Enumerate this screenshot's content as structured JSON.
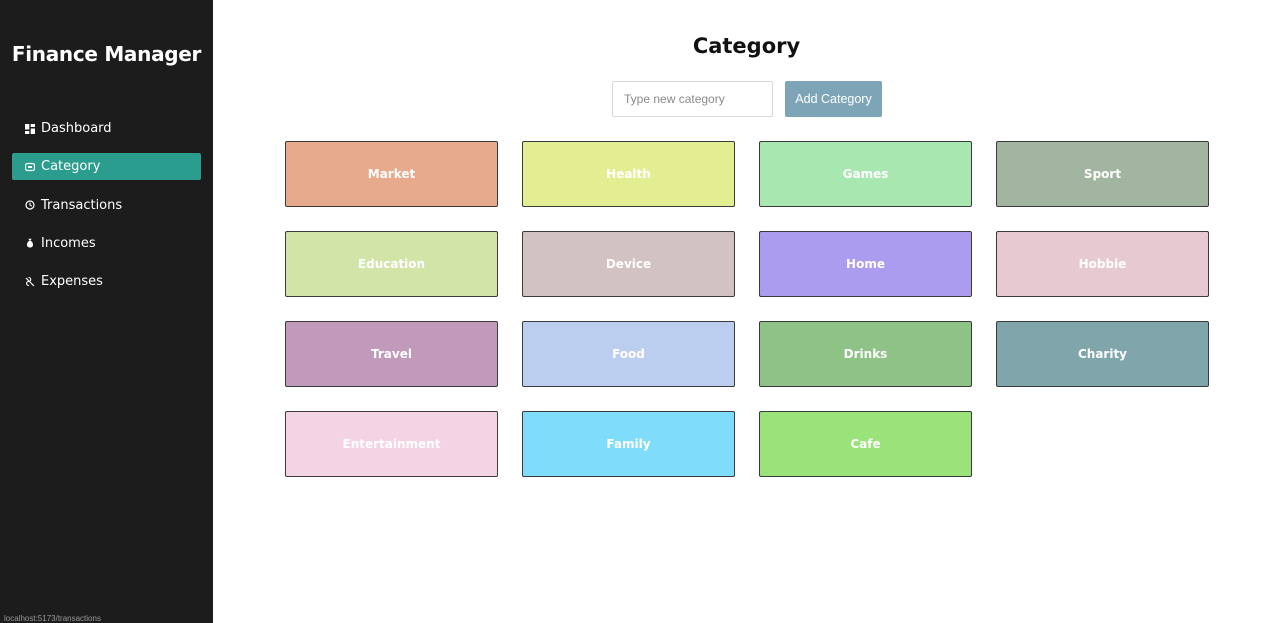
{
  "sidebar": {
    "brand": "Finance Manager",
    "items": [
      {
        "label": "Dashboard",
        "icon": "dashboard-icon",
        "active": false
      },
      {
        "label": "Category",
        "icon": "category-icon",
        "active": true
      },
      {
        "label": "Transactions",
        "icon": "history-icon",
        "active": false
      },
      {
        "label": "Incomes",
        "icon": "money-bag-icon",
        "active": false
      },
      {
        "label": "Expenses",
        "icon": "expenses-icon",
        "active": false
      }
    ],
    "active_color": "#2a9d8f",
    "status_url": "localhost:5173/transactions"
  },
  "main": {
    "title": "Category",
    "input_placeholder": "Type new category",
    "input_value": "",
    "add_button_label": "Add Category",
    "categories": [
      {
        "name": "Market",
        "color": "#e8aa8c"
      },
      {
        "name": "Health",
        "color": "#e3ee93"
      },
      {
        "name": "Games",
        "color": "#a9e7b1"
      },
      {
        "name": "Sport",
        "color": "#a2b5a0"
      },
      {
        "name": "Education",
        "color": "#d2e4a8"
      },
      {
        "name": "Device",
        "color": "#d2c2c2"
      },
      {
        "name": "Home",
        "color": "#ac9cf0"
      },
      {
        "name": "Hobbie",
        "color": "#e7cad1"
      },
      {
        "name": "Travel",
        "color": "#c199bb"
      },
      {
        "name": "Food",
        "color": "#bccef0"
      },
      {
        "name": "Drinks",
        "color": "#8ec287"
      },
      {
        "name": "Charity",
        "color": "#80a6ab"
      },
      {
        "name": "Entertainment",
        "color": "#f4d3e4"
      },
      {
        "name": "Family",
        "color": "#7fdcfa"
      },
      {
        "name": "Cafe",
        "color": "#9ae27a"
      }
    ]
  }
}
